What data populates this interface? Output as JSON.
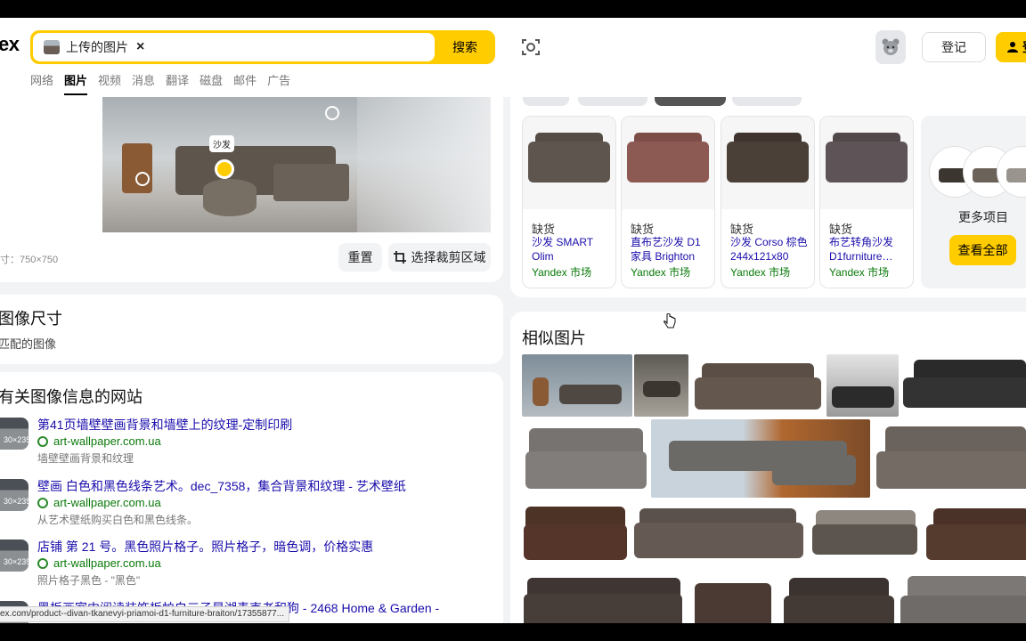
{
  "header": {
    "logo": "ex",
    "search_chip_label": "上传的图片",
    "search_chip_close": "×",
    "search_button": "搜索",
    "login_button": "登记",
    "user_button_text": "登",
    "nav": [
      "网络",
      "图片",
      "视频",
      "消息",
      "翻译",
      "磁盘",
      "邮件",
      "广告"
    ],
    "nav_active": "图片"
  },
  "image_panel": {
    "hotspot_tag": "沙发",
    "size_text": "寸：750×750",
    "reset_button": "重置",
    "crop_button": "选择裁剪区域"
  },
  "size_section": {
    "title": "图像尺寸",
    "subtitle": "匹配的图像"
  },
  "sites_section": {
    "title": "有关图像信息的网站",
    "items": [
      {
        "thumb_label": "30×235",
        "title": "第41页墙壁壁画背景和墙壁上的纹理-定制印刷",
        "domain": "art-wallpaper.com.ua",
        "desc": "墙壁壁画背景和纹理"
      },
      {
        "thumb_label": "30×235",
        "title": "壁画 白色和黑色线条艺术。dec_7358，集合背景和纹理 - 艺术壁纸",
        "domain": "art-wallpaper.com.ua",
        "desc": "从艺术壁纸购买白色和黑色线条。"
      },
      {
        "thumb_label": "30×235",
        "title": "店铺 第 21 号。黑色照片格子。照片格子，暗色调，价格实惠",
        "domain": "art-wallpaper.com.ua",
        "desc": "照片格子黑色 - \"黑色\""
      },
      {
        "thumb_label": "",
        "title": "黑板画室内阅读装饰板帕白三子星湖麦克老和狗 - 2468 Home & Garden -",
        "domain": "",
        "desc": ""
      }
    ]
  },
  "status_url": "ex.com/product--divan-tkanevyi-priamoi-d1-furniture-braiton/17355877...",
  "products": {
    "items": [
      {
        "stock": "缺货",
        "name": "沙发 SMART Olim",
        "store": "Yandex 市场",
        "color": "#5d554e",
        "back": "#544c45"
      },
      {
        "stock": "缺货",
        "name": "直布艺沙发 D1 家具 Brighton",
        "store": "Yandex 市场",
        "color": "#8c5a52",
        "back": "#7d4e47"
      },
      {
        "stock": "缺货",
        "name": "沙发 Corso 棕色 244x121x80",
        "store": "Yandex 市场",
        "color": "#4b4038",
        "back": "#3f352e"
      },
      {
        "stock": "缺货",
        "name": "布艺转角沙发 D1furniture…",
        "store": "Yandex 市场",
        "color": "#5e5457",
        "back": "#51484a"
      }
    ],
    "more_label": "更多项目",
    "view_all_button": "查看全部"
  },
  "similar": {
    "title": "相似图片"
  },
  "colors": {
    "accent": "#ffcc00",
    "link": "#1a0dab",
    "domain": "#0a7a0a",
    "panel_bg": "#f2f3f5"
  }
}
